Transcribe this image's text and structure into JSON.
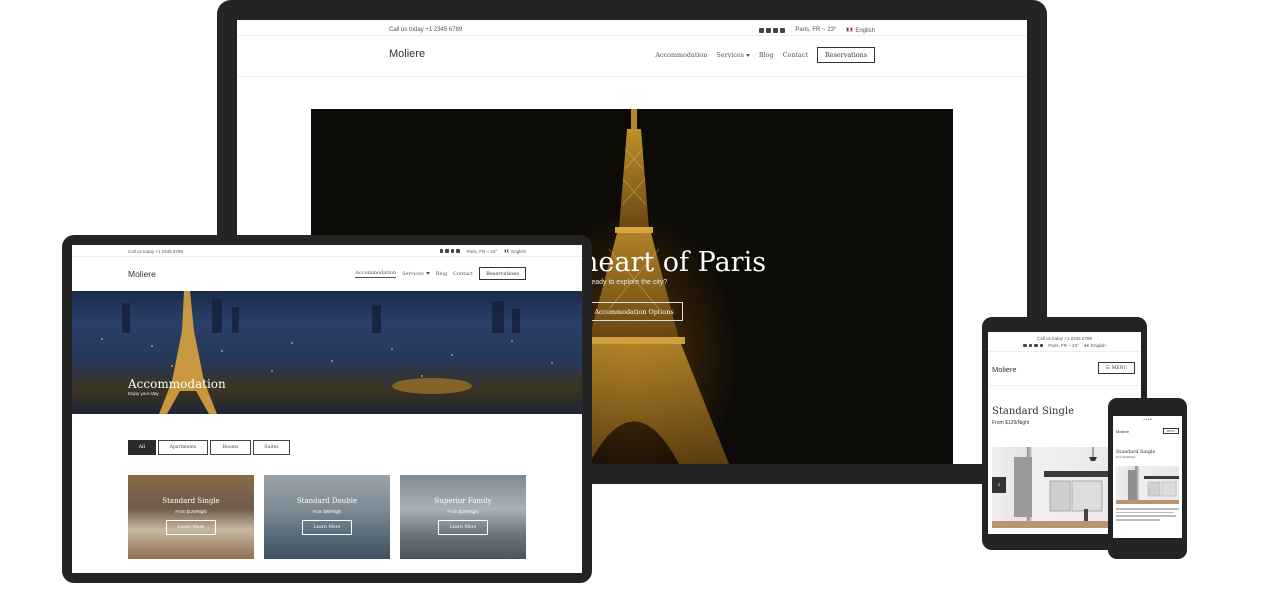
{
  "site": {
    "phone_text": "Call us today +1 2345 6789",
    "weather": "Paris, FR ~ 23°",
    "language": "English",
    "logo": "Moliere"
  },
  "nav": {
    "accommodation": "Accommodation",
    "services": "Services",
    "blog": "Blog",
    "contact": "Contact",
    "reservations": "Reservations"
  },
  "laptop": {
    "hero_title": "heart of Paris",
    "hero_subtitle": "ready to explore the city?",
    "hero_button": "Accommodation Options"
  },
  "tablet": {
    "hero_title": "Accommodation",
    "hero_subtitle": "Enjoy your stay",
    "filters": [
      "All",
      "Apartments",
      "Rooms",
      "Suites"
    ],
    "cards": [
      {
        "title": "Standard Single",
        "price": "From $129/Night",
        "button": "Learn More"
      },
      {
        "title": "Standard Double",
        "price": "From $99/Night",
        "button": "Learn More"
      },
      {
        "title": "Superior Family",
        "price": "From $109/Night",
        "button": "Learn More"
      }
    ]
  },
  "small_tablet": {
    "menu_label": "MENU",
    "room_title": "Standard Single",
    "room_price": "From $129/Night",
    "arrow": "‹"
  },
  "phone": {
    "logo": "Moliere",
    "menu_label": "MENU",
    "room_title": "Standard Single",
    "room_price": "From $129/Night"
  }
}
